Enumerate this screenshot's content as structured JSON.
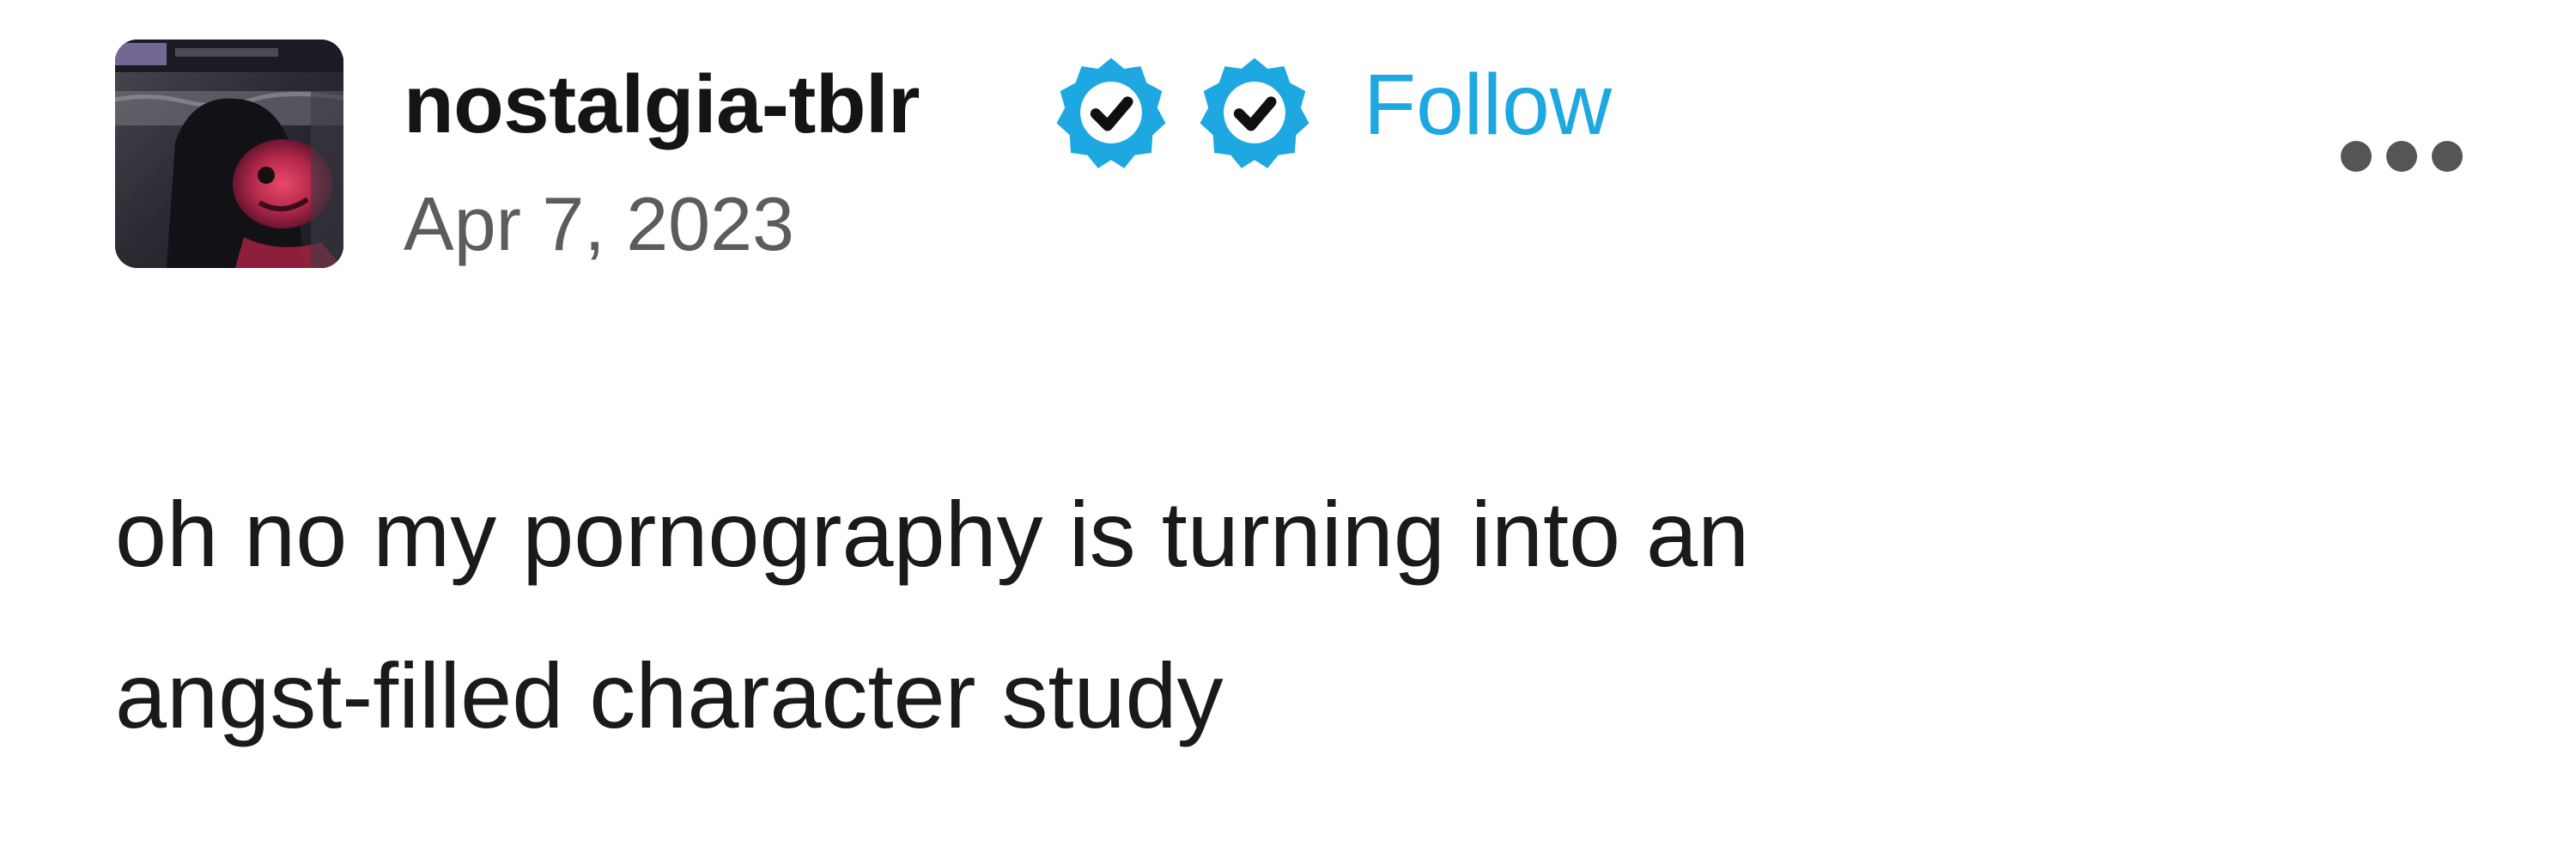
{
  "post": {
    "blog_name": "nostalgia-tblr",
    "verified_badges": [
      "verified-badge-icon",
      "verified-badge-icon"
    ],
    "follow_label": "Follow",
    "date": "Apr 7, 2023",
    "more_options_icon": "more-horizontal-icon",
    "text_lines": [
      "oh no my pornography is turning into an",
      "angst-filled character study"
    ]
  },
  "colors": {
    "accent": "#1ea8e1",
    "text": "#1a1a1a",
    "muted": "#5c5c5c",
    "background": "#ffffff"
  }
}
